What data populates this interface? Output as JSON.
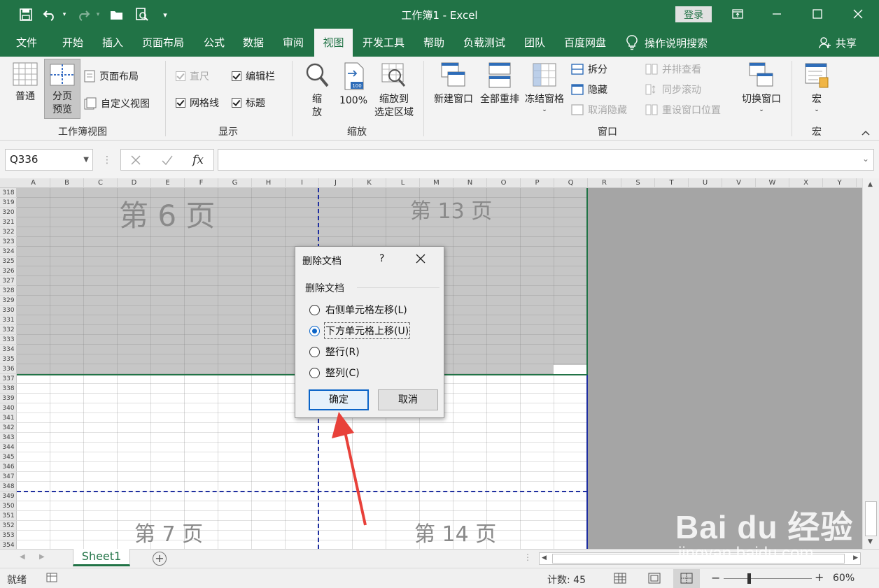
{
  "window": {
    "title": "工作簿1  -  Excel",
    "login_label": "登录"
  },
  "tabs": [
    {
      "label": "文件"
    },
    {
      "label": "开始"
    },
    {
      "label": "插入"
    },
    {
      "label": "页面布局"
    },
    {
      "label": "公式"
    },
    {
      "label": "数据"
    },
    {
      "label": "审阅"
    },
    {
      "label": "视图",
      "active": true
    },
    {
      "label": "开发工具"
    },
    {
      "label": "帮助"
    },
    {
      "label": "负载测试"
    },
    {
      "label": "团队"
    },
    {
      "label": "百度网盘"
    }
  ],
  "tell_me": "操作说明搜索",
  "share_label": "共享",
  "ribbon": {
    "workbook_views": {
      "group_label": "工作簿视图",
      "normal": "普通",
      "page_break_preview_line1": "分页",
      "page_break_preview_line2": "预览",
      "page_layout": "页面布局",
      "custom_views": "自定义视图"
    },
    "show": {
      "group_label": "显示",
      "ruler": "直尺",
      "formula_bar": "编辑栏",
      "gridlines": "网格线",
      "headings": "标题"
    },
    "zoom": {
      "group_label": "缩放",
      "zoom_line1": "缩",
      "zoom_line2": "放",
      "zoom_100": "100%",
      "zoom_badge": "100",
      "zoom_selection_line1": "缩放到",
      "zoom_selection_line2": "选定区域"
    },
    "window": {
      "group_label": "窗口",
      "new_window": "新建窗口",
      "arrange_all": "全部重排",
      "freeze_panes": "冻结窗格",
      "split": "拆分",
      "hide": "隐藏",
      "unhide": "取消隐藏",
      "side_by_side": "并排查看",
      "sync_scroll": "同步滚动",
      "reset_position": "重设窗口位置",
      "switch_windows": "切换窗口"
    },
    "macros": {
      "group_label": "宏",
      "macros": "宏"
    }
  },
  "formula_bar": {
    "name_box": "Q336",
    "fx": "fx",
    "value": ""
  },
  "columns": [
    "A",
    "B",
    "C",
    "D",
    "E",
    "F",
    "G",
    "H",
    "I",
    "J",
    "K",
    "L",
    "M",
    "N",
    "O",
    "P",
    "Q",
    "R",
    "S",
    "T",
    "U",
    "V",
    "W",
    "X",
    "Y"
  ],
  "rows": [
    "318",
    "319",
    "320",
    "321",
    "322",
    "323",
    "324",
    "325",
    "326",
    "327",
    "328",
    "329",
    "330",
    "331",
    "332",
    "333",
    "334",
    "335",
    "336",
    "337",
    "338",
    "339",
    "340",
    "341",
    "342",
    "343",
    "344",
    "345",
    "346",
    "347",
    "348",
    "349",
    "350",
    "351",
    "352",
    "353",
    "354"
  ],
  "page_labels": {
    "p6": "第 6 页",
    "p13": "第 13 页",
    "p7": "第 7 页",
    "p14": "第 14 页"
  },
  "dialog": {
    "title": "删除文档",
    "help": "?",
    "group_label": "删除文档",
    "options": [
      {
        "label": "右侧单元格左移(L)",
        "selected": false
      },
      {
        "label": "下方单元格上移(U)",
        "selected": true
      },
      {
        "label": "整行(R)",
        "selected": false
      },
      {
        "label": "整列(C)",
        "selected": false
      }
    ],
    "ok": "确定",
    "cancel": "取消"
  },
  "sheets": [
    {
      "label": "Sheet1",
      "active": true
    }
  ],
  "status": {
    "ready": "就绪",
    "count": "计数: 45",
    "zoom": "60%"
  },
  "watermark": {
    "brand": "Bai du 经验",
    "url": "jingyan.baidu.com"
  },
  "colors": {
    "excel_green": "#217346",
    "page_break_blue": "#1f2fa0",
    "annotation_red": "#e8413a"
  }
}
